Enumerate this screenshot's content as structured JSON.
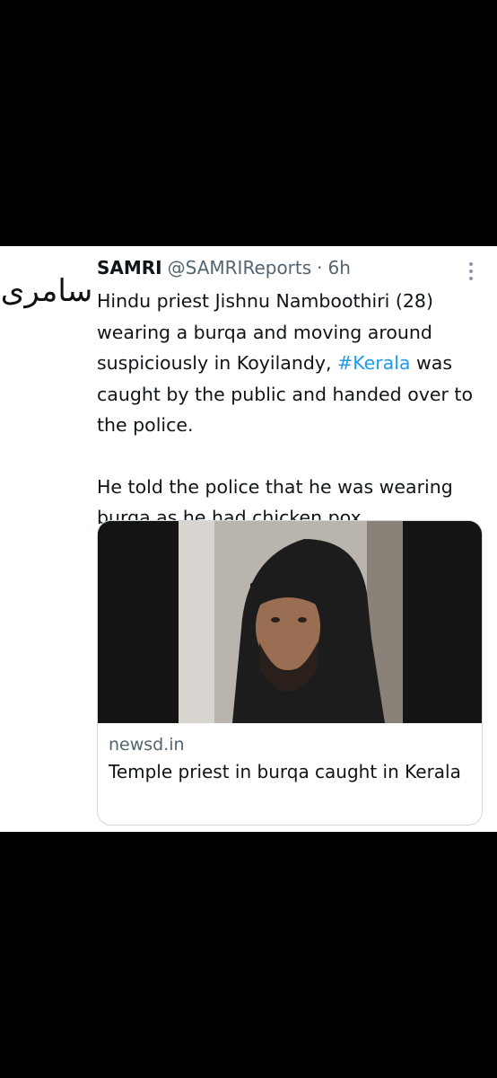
{
  "tweet": {
    "avatar_text": "سامری",
    "display_name": "SAMRI",
    "handle": "@SAMRIReports",
    "separator": "·",
    "time": "6h",
    "text_line1": "Hindu priest Jishnu Namboothiri (28) wearing a burqa and moving around suspiciously in Koyilandy, ",
    "hashtag": "#Kerala",
    "text_line1_end": " was caught by the public and handed over to the police.",
    "text_para2": "He told the police that he was wearing burqa as he had chicken pox.",
    "more_icon": "more-dots-icon"
  },
  "link_card": {
    "image_description_icon": "photo-thumbnail",
    "domain": "newsd.in",
    "title": "Temple priest in burqa caught in Kerala"
  },
  "colors": {
    "hashtag": "#1d9bf0",
    "secondary_text": "#536471",
    "primary_text": "#0f1419",
    "background": "#000000"
  }
}
